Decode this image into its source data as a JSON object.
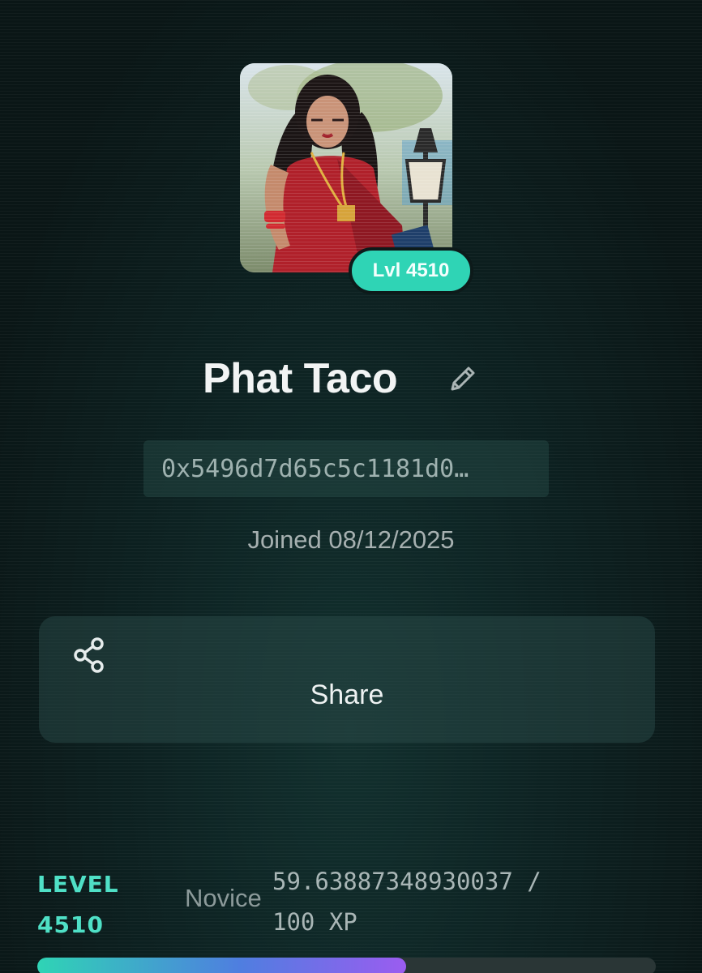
{
  "profile": {
    "level_badge": "Lvl 4510",
    "name": "Phat Taco",
    "address": "0x5496d7d65c5c1181d0…",
    "joined": "Joined 08/12/2025"
  },
  "actions": {
    "share_label": "Share"
  },
  "level": {
    "label_line1": "LEVEL",
    "label_line2": "4510",
    "tier": "Novice",
    "xp_line1": "59.63887348930037 /",
    "xp_line2": "100 XP",
    "progress_fraction": 0.596
  },
  "icons": {
    "edit": "pencil-icon",
    "share": "share-icon"
  },
  "colors": {
    "accent": "#2fd4b5",
    "progress_end": "#9b5cf0"
  }
}
